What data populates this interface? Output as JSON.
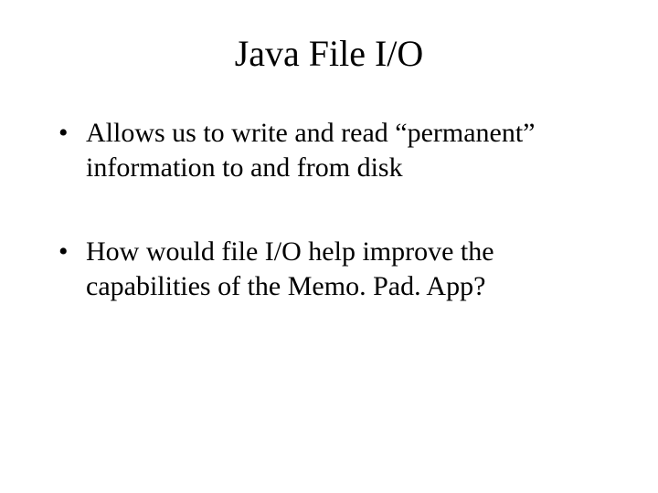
{
  "slide": {
    "title": "Java File I/O",
    "bullets": [
      "Allows us to write and read “permanent” information to and from disk",
      "How would file I/O help improve the capabilities of the Memo. Pad. App?"
    ]
  }
}
